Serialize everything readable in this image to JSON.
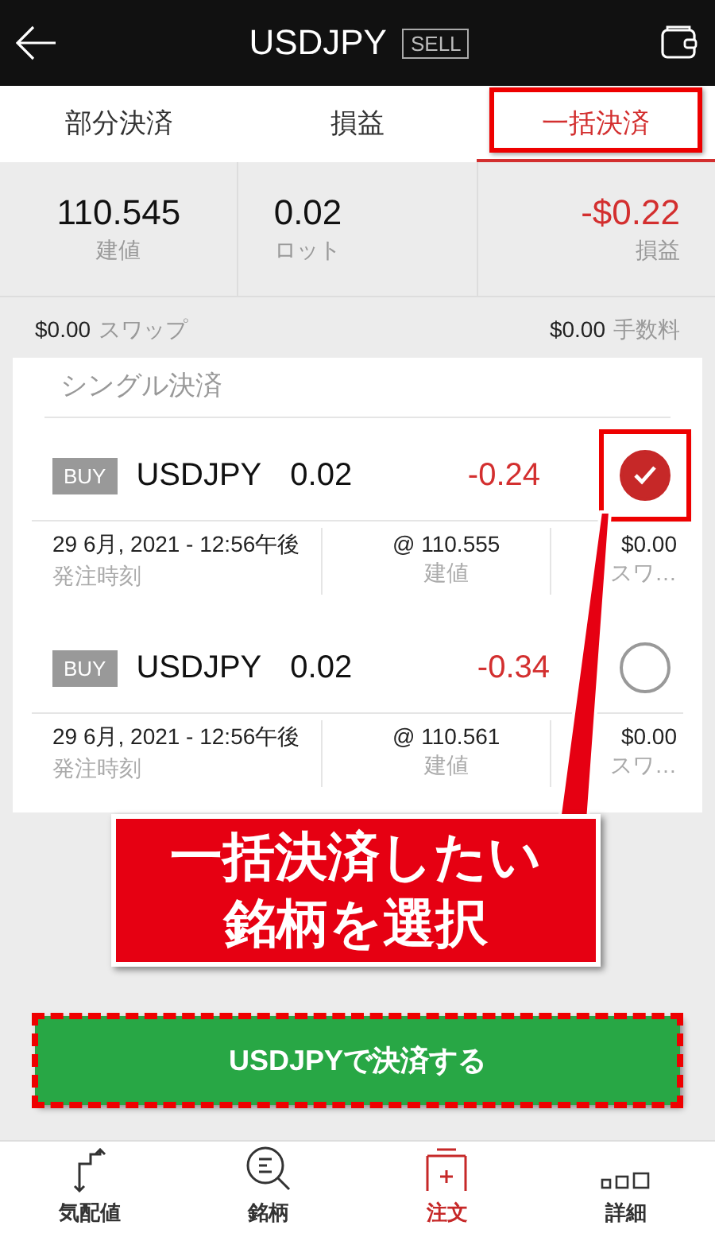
{
  "header": {
    "title": "USDJPY",
    "side": "SELL"
  },
  "tabs": [
    {
      "label": "部分決済",
      "selected": false,
      "highlighted": false
    },
    {
      "label": "損益",
      "selected": false,
      "highlighted": false
    },
    {
      "label": "一括決済",
      "selected": true,
      "highlighted": true
    }
  ],
  "summary": [
    {
      "value": "110.545",
      "label": "建値",
      "negative": false
    },
    {
      "value": "0.02",
      "label": "ロット",
      "negative": false
    },
    {
      "value": "-$0.22",
      "label": "損益",
      "negative": true
    }
  ],
  "fees": [
    {
      "value": "$0.00",
      "label": "スワップ"
    },
    {
      "value": "$0.00",
      "label": "手数料"
    }
  ],
  "section_title": "シングル決済",
  "positions": [
    {
      "side": "BUY",
      "symbol": "USDJPY",
      "lot": "0.02",
      "pnl": "-0.24",
      "selected": true,
      "highlighted": true,
      "time": "29 6月, 2021 - 12:56午後",
      "time_label": "発注時刻",
      "price": "@ 110.555",
      "price_label": "建値",
      "swap": "$0.00",
      "swap_label": "スワ…"
    },
    {
      "side": "BUY",
      "symbol": "USDJPY",
      "lot": "0.02",
      "pnl": "-0.34",
      "selected": false,
      "highlighted": false,
      "time": "29 6月, 2021 - 12:56午後",
      "time_label": "発注時刻",
      "price": "@ 110.561",
      "price_label": "建値",
      "swap": "$0.00",
      "swap_label": "スワ…"
    }
  ],
  "callout": {
    "lines": [
      "一括決済したい",
      "銘柄を選択"
    ]
  },
  "close_button": {
    "label": "USDJPYで決済する",
    "highlighted": true
  },
  "nav": [
    {
      "label": "気配値",
      "selected": false,
      "kind": "quotes"
    },
    {
      "label": "銘柄",
      "selected": false,
      "kind": "search"
    },
    {
      "label": "注文",
      "selected": true,
      "kind": "order"
    },
    {
      "label": "詳細",
      "selected": false,
      "kind": "details"
    }
  ]
}
